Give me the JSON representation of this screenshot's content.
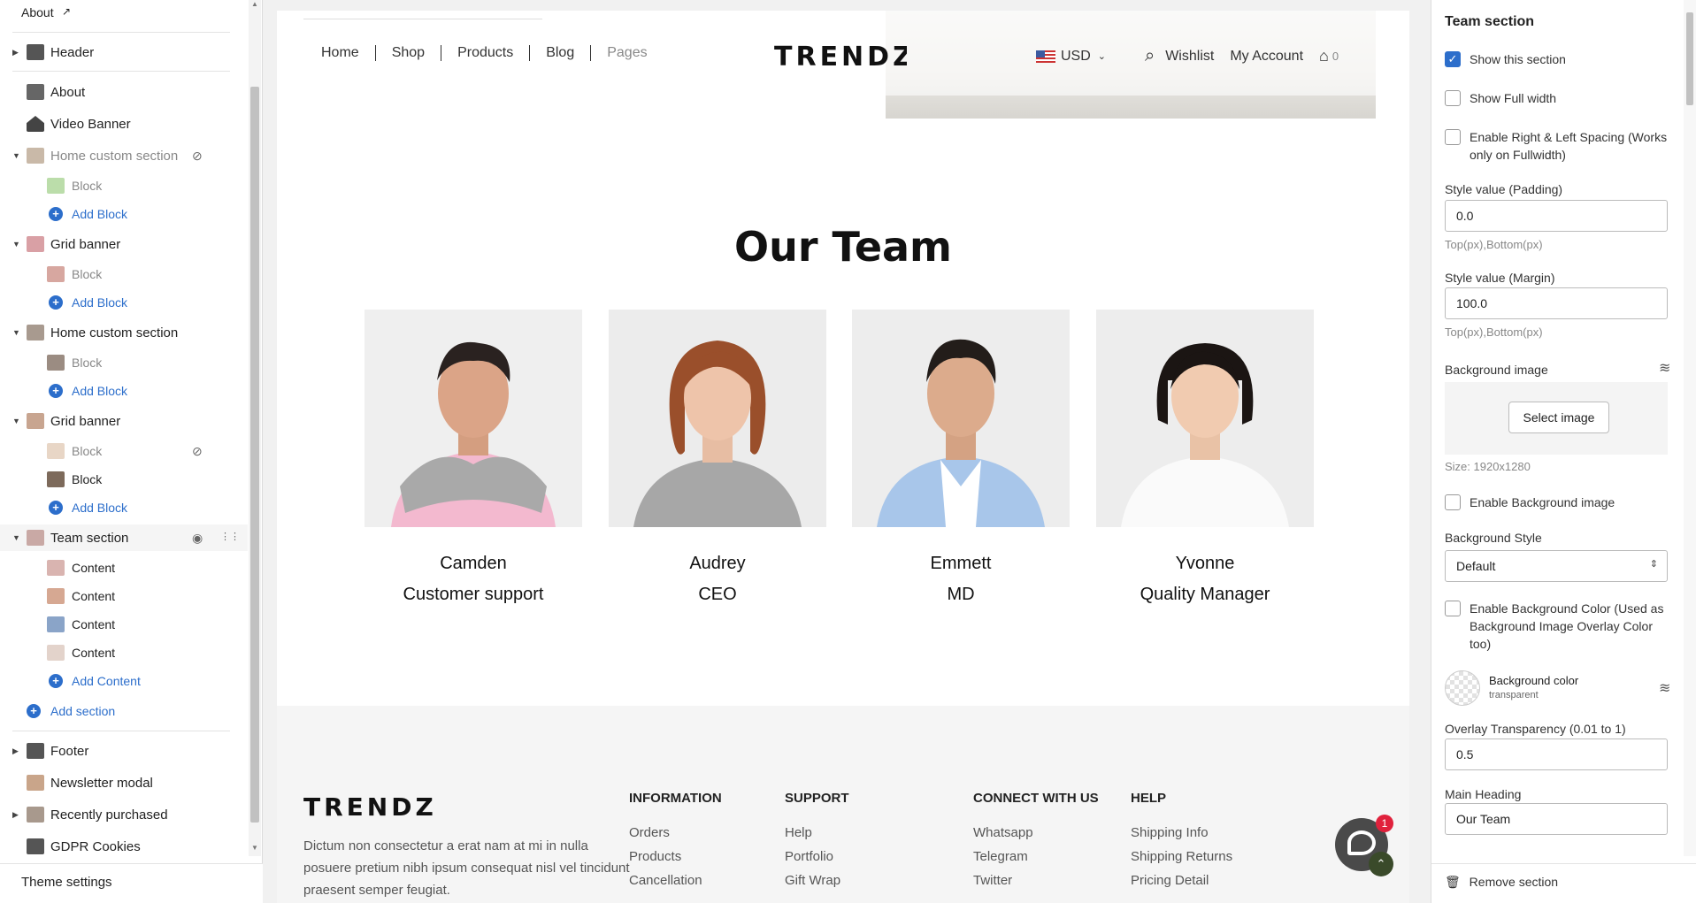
{
  "sidebar": {
    "top_link": "About",
    "items": [
      {
        "label": "Header"
      },
      {
        "label": "About"
      },
      {
        "label": "Video Banner"
      },
      {
        "label": "Home custom section"
      },
      {
        "label": "Block"
      },
      {
        "label": "Add Block"
      },
      {
        "label": "Grid banner"
      },
      {
        "label": "Block"
      },
      {
        "label": "Add Block"
      },
      {
        "label": "Home custom section"
      },
      {
        "label": "Block"
      },
      {
        "label": "Add Block"
      },
      {
        "label": "Grid banner"
      },
      {
        "label": "Block"
      },
      {
        "label": "Block"
      },
      {
        "label": "Add Block"
      },
      {
        "label": "Team section"
      },
      {
        "label": "Content"
      },
      {
        "label": "Content"
      },
      {
        "label": "Content"
      },
      {
        "label": "Content"
      },
      {
        "label": "Add Content"
      },
      {
        "label": "Add section"
      },
      {
        "label": "Footer"
      },
      {
        "label": "Newsletter modal"
      },
      {
        "label": "Recently purchased"
      },
      {
        "label": "GDPR Cookies"
      }
    ],
    "theme_settings": "Theme settings"
  },
  "preview": {
    "nav": [
      "Home",
      "Shop",
      "Products",
      "Blog",
      "Pages"
    ],
    "logo": "TRENDZ",
    "currency": "USD",
    "wishlist": "Wishlist",
    "account": "My Account",
    "cart_count": "0",
    "team_heading": "Our Team",
    "members": [
      {
        "name": "Camden",
        "role": "Customer support"
      },
      {
        "name": "Audrey",
        "role": "CEO"
      },
      {
        "name": "Emmett",
        "role": "MD"
      },
      {
        "name": "Yvonne",
        "role": "Quality Manager"
      }
    ],
    "footer": {
      "logo": "TRENDZ",
      "text": "Dictum non consectetur a erat nam at mi in nulla posuere pretium nibh ipsum consequat nisl vel tincidunt praesent semper feugiat.",
      "columns": [
        {
          "heading": "INFORMATION",
          "links": [
            "Orders",
            "Products",
            "Cancellation"
          ]
        },
        {
          "heading": "SUPPORT",
          "links": [
            "Help",
            "Portfolio",
            "Gift Wrap"
          ]
        },
        {
          "heading": "CONNECT WITH US",
          "links": [
            "Whatsapp",
            "Telegram",
            "Twitter"
          ]
        },
        {
          "heading": "HELP",
          "links": [
            "Shipping Info",
            "Shipping Returns",
            "Pricing Detail"
          ]
        }
      ]
    },
    "chat_badge": "1"
  },
  "settings": {
    "title": "Team section",
    "show_section": "Show this section",
    "show_full_width": "Show Full width",
    "enable_spacing": "Enable Right & Left Spacing (Works only on Fullwidth)",
    "padding_label": "Style value (Padding)",
    "padding_value": "0.0",
    "padding_hint": "Top(px),Bottom(px)",
    "margin_label": "Style value (Margin)",
    "margin_value": "100.0",
    "margin_hint": "Top(px),Bottom(px)",
    "bg_image_label": "Background image",
    "select_image": "Select image",
    "size_hint": "Size: 1920x1280",
    "enable_bg_image": "Enable Background image",
    "bg_style_label": "Background Style",
    "bg_style_value": "Default",
    "enable_bg_color": "Enable Background Color (Used as Background Image Overlay Color too)",
    "bg_color_label": "Background color",
    "bg_color_value": "transparent",
    "overlay_label": "Overlay Transparency (0.01 to 1)",
    "overlay_value": "0.5",
    "main_heading_label": "Main Heading",
    "main_heading_value": "Our Team",
    "remove_section": "Remove section"
  },
  "colors": {
    "accent": "#2c6ecb",
    "highlight": "#eee3d4",
    "badge": "#e0213c"
  }
}
